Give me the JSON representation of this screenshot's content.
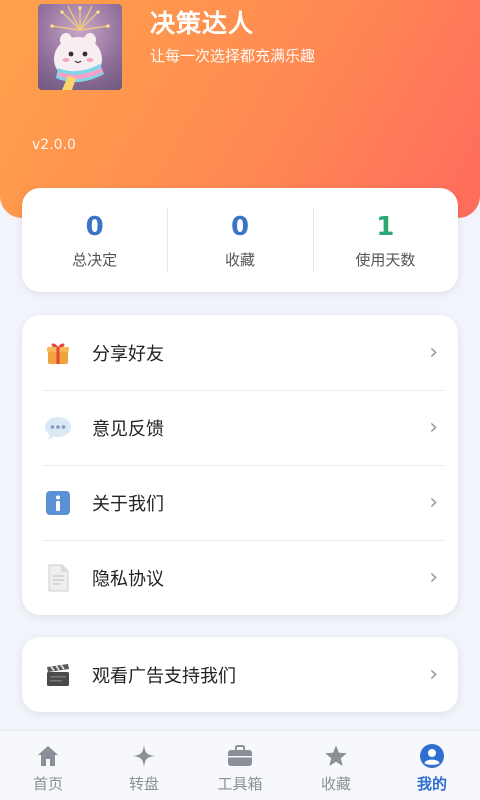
{
  "profile": {
    "app_name": "决策达人",
    "slogan": "让每一次选择都充满乐趣",
    "version": "v2.0.0",
    "avatar_icon": "cute-character-fireworks-avatar"
  },
  "stats": [
    {
      "value": "0",
      "label": "总决定",
      "color": "#3b74c7"
    },
    {
      "value": "0",
      "label": "收藏",
      "color": "#3b74c7"
    },
    {
      "value": "1",
      "label": "使用天数",
      "color": "#2aa876"
    }
  ],
  "menu": [
    {
      "label": "分享好友",
      "icon": "gift-icon"
    },
    {
      "label": "意见反馈",
      "icon": "speech-bubble-icon"
    },
    {
      "label": "关于我们",
      "icon": "info-icon"
    },
    {
      "label": "隐私协议",
      "icon": "document-icon"
    }
  ],
  "ad": {
    "label": "观看广告支持我们",
    "icon": "clapperboard-icon"
  },
  "chevron": "›",
  "tabs": [
    {
      "label": "首页",
      "icon": "home-icon",
      "active": false
    },
    {
      "label": "转盘",
      "icon": "sparkle-icon",
      "active": false
    },
    {
      "label": "工具箱",
      "icon": "toolbox-icon",
      "active": false
    },
    {
      "label": "收藏",
      "icon": "star-icon",
      "active": false
    },
    {
      "label": "我的",
      "icon": "user-icon",
      "active": true
    }
  ],
  "colors": {
    "header_start": "#ffa24a",
    "header_end": "#ff6b5e",
    "accent": "#2f6fd0",
    "stat_blue": "#3b74c7",
    "stat_green": "#2aa876"
  }
}
